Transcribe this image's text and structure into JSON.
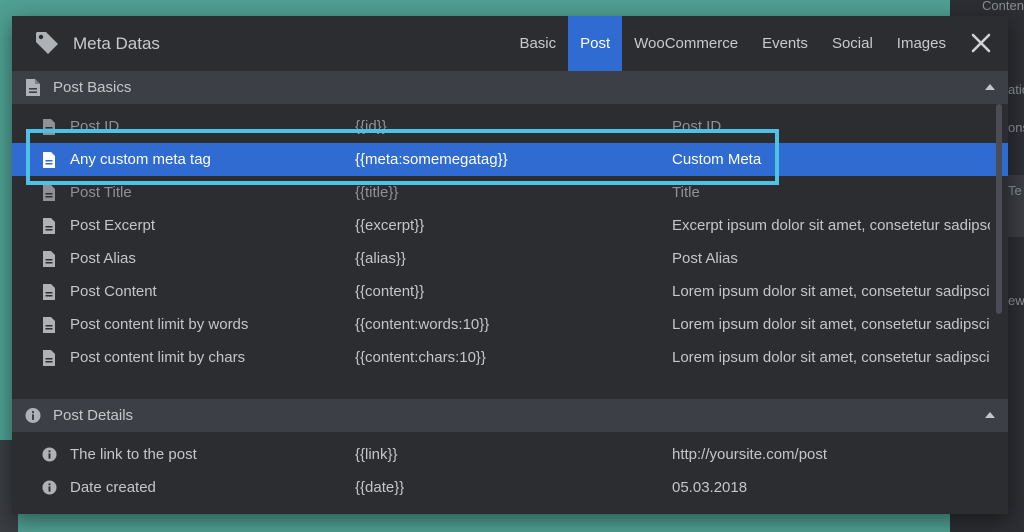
{
  "modal": {
    "title": "Meta Datas",
    "tabs": [
      {
        "label": "Basic",
        "active": false
      },
      {
        "label": "Post",
        "active": true
      },
      {
        "label": "WooCommerce",
        "active": false
      },
      {
        "label": "Events",
        "active": false
      },
      {
        "label": "Social",
        "active": false
      },
      {
        "label": "Images",
        "active": false
      }
    ]
  },
  "sections": [
    {
      "title": "Post Basics",
      "rows": [
        {
          "name": "Post ID",
          "tag": "{{id}}",
          "value": "Post ID"
        },
        {
          "name": "Any custom meta tag",
          "tag": "{{meta:somemegatag}}",
          "value": "Custom Meta"
        },
        {
          "name": "Post Title",
          "tag": "{{title}}",
          "value": "Title"
        },
        {
          "name": "Post Excerpt",
          "tag": "{{excerpt}}",
          "value": "Excerpt ipsum dolor sit amet, consetetur sadipscing"
        },
        {
          "name": "Post Alias",
          "tag": "{{alias}}",
          "value": "Post Alias"
        },
        {
          "name": "Post Content",
          "tag": "{{content}}",
          "value": "Lorem ipsum dolor sit amet, consetetur sadipscing"
        },
        {
          "name": "Post content limit by words",
          "tag": "{{content:words:10}}",
          "value": "Lorem ipsum dolor sit amet, consetetur sadipscing"
        },
        {
          "name": "Post content limit by chars",
          "tag": "{{content:chars:10}}",
          "value": "Lorem ipsum dolor sit amet, consetetur sadipscing"
        }
      ]
    },
    {
      "title": "Post Details",
      "rows": [
        {
          "name": "The link to the post",
          "tag": "{{link}}",
          "value": "http://yoursite.com/post"
        },
        {
          "name": "Date created",
          "tag": "{{date}}",
          "value": "05.03.2018"
        }
      ]
    }
  ],
  "background": {
    "fragments": [
      "Conten",
      "atio",
      "ons",
      "Te",
      "ew"
    ]
  },
  "colors": {
    "accent": "#2f6bd0",
    "highlight_border": "#4fc0e6",
    "modal_bg": "#2b2d31",
    "section_bg": "#3c3f45",
    "backdrop": "#4f9f92"
  }
}
